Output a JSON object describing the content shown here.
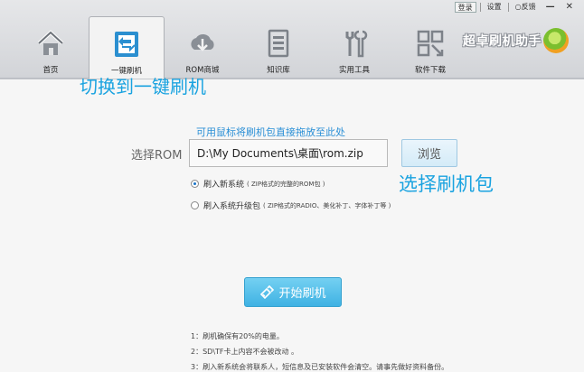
{
  "window_controls": {
    "login": "登录",
    "settings": "设置",
    "feedback": "反馈",
    "minimize": "—",
    "close": "✕"
  },
  "tabs": [
    {
      "label": "首页",
      "icon": "home-icon"
    },
    {
      "label": "一键刷机",
      "icon": "flash-icon",
      "active": true
    },
    {
      "label": "ROM商城",
      "icon": "cloud-download-icon"
    },
    {
      "label": "知识库",
      "icon": "document-icon"
    },
    {
      "label": "实用工具",
      "icon": "tools-icon"
    },
    {
      "label": "软件下载",
      "icon": "apps-icon"
    }
  ],
  "brand": {
    "title": "超卓刷机助手"
  },
  "annotations": {
    "switch": "切换到一键刷机",
    "choose": "选择刷机包"
  },
  "rom": {
    "drag_hint": "可用鼠标将刷机包直接拖放至此处",
    "label": "选择ROM",
    "path": "D:\\My Documents\\桌面\\rom.zip",
    "browse_label": "浏览"
  },
  "options": [
    {
      "label": "刷入新系统",
      "note": "( ZIP格式的完整的ROM包 )",
      "selected": true
    },
    {
      "label": "刷入系统升级包",
      "note": "( ZIP格式的RADIO、美化补丁、字体补丁等 )",
      "selected": false
    }
  ],
  "start_button": {
    "label": "开始刷机"
  },
  "notes": [
    "1：刷机确保有20%的电量。",
    "2：SD\\TF卡上内容不会被改动 。",
    "3：刷入新系统会将联系人，短信息及已安装软件会清空。请事先做好资料备份。"
  ],
  "colors": {
    "accent": "#1aa3e0",
    "start_button": "#4fbfe9"
  }
}
